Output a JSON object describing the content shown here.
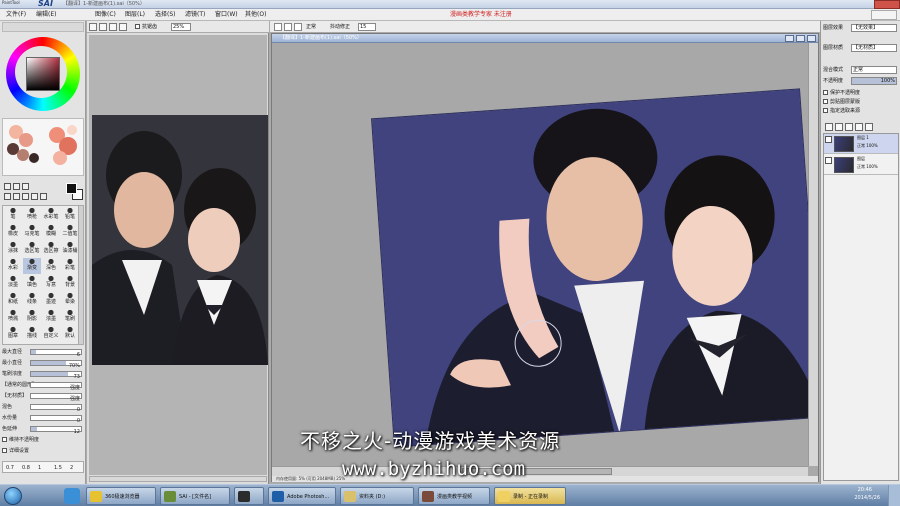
{
  "app": {
    "logo_small": "PaintTool",
    "logo_main": "SAI",
    "title": "【翻译】1-新建画布(1).sai（50%）",
    "menu": [
      "文件(F)",
      "编辑(E)",
      "图像(C)",
      "图层(L)",
      "选择(S)",
      "滤镜(T)",
      "窗口(W)",
      "其他(O)"
    ],
    "titlebar_notice": "漫画类教学专家 未注册"
  },
  "nav": {
    "antialias_label": "抗锯齿",
    "zoom_value": "25%"
  },
  "canvas_toolbar": {
    "label_a": "正常",
    "label_b": "抖动修正",
    "value_b": "15"
  },
  "document": {
    "title": "【翻译】1-新建画布(1).sai（50%）",
    "status": "内存使用量: 5%  (可用 2048MB)     25%"
  },
  "brush": {
    "tools": [
      "笔",
      "喷枪",
      "水彩笔",
      "铅笔",
      "橡皮",
      "马克笔",
      "模糊",
      "二值笔",
      "涂抹",
      "选区笔",
      "选区擦",
      "油漆桶",
      "水彩",
      "渐变",
      "深色",
      "彩笔",
      "淡墨",
      "填色",
      "写意",
      "背景",
      "和纸",
      "线条",
      "墨迹",
      "晕染",
      "喷溅",
      "阴影",
      "浓墨",
      "笔刷",
      "图章",
      "描线",
      "自定义",
      "默认"
    ],
    "settings": [
      {
        "label": "最大直径",
        "value": "6"
      },
      {
        "label": "最小直径",
        "value": "70%"
      },
      {
        "label": "笔刷浓度",
        "value": "73"
      },
      {
        "label": "【通常的圆形】",
        "value": "强度"
      },
      {
        "label": "【无材质】",
        "value": "强度"
      },
      {
        "label": "混色",
        "value": "0"
      },
      {
        "label": "水份量",
        "value": "0"
      },
      {
        "label": "色延伸",
        "value": "12"
      },
      {
        "label": "维持不透明度",
        "value": ""
      },
      {
        "label": "详细设置",
        "value": ""
      }
    ],
    "sizes": [
      "0.7",
      "0.8",
      "1",
      "1.5",
      "2"
    ]
  },
  "right_panel": {
    "rows": [
      {
        "label": "图层效果",
        "value": "【无效果】"
      },
      {
        "label": "图层材质",
        "value": "【无材质】"
      },
      {
        "label": "混合模式",
        "value": "正常"
      },
      {
        "label": "不透明度",
        "value": "100%"
      }
    ],
    "checks": [
      "保护不透明度",
      "剪贴图层蒙版",
      "指定选取来源"
    ],
    "layers": [
      {
        "name": "图层 1",
        "sub": "正常 100%"
      },
      {
        "name": "图层",
        "sub": "正常 100%"
      }
    ]
  },
  "watermark": {
    "cn": "不移之火-动漫游戏美术资源",
    "url": "www.byzhihuo.com"
  },
  "taskbar": {
    "tasks": [
      {
        "label": "360极速浏览器",
        "color": "#e6c231"
      },
      {
        "label": "SAI - [文件名]",
        "color": "#6a8d3a"
      },
      {
        "label": "",
        "color": "#2b2b2b"
      },
      {
        "label": "Adobe Photosh...",
        "color": "#1f5fa8"
      },
      {
        "label": "资料夹 (D:)",
        "color": "#d9c06a"
      },
      {
        "label": "漫画类教学视频",
        "color": "#7a4a3a"
      },
      {
        "label": "录制 - 正在录制",
        "color": "#f0d060"
      }
    ],
    "time": "20:46",
    "date": "2014/5/26"
  },
  "colors": {
    "accent": "#3b3f79",
    "wm_text": "#ffffff"
  }
}
